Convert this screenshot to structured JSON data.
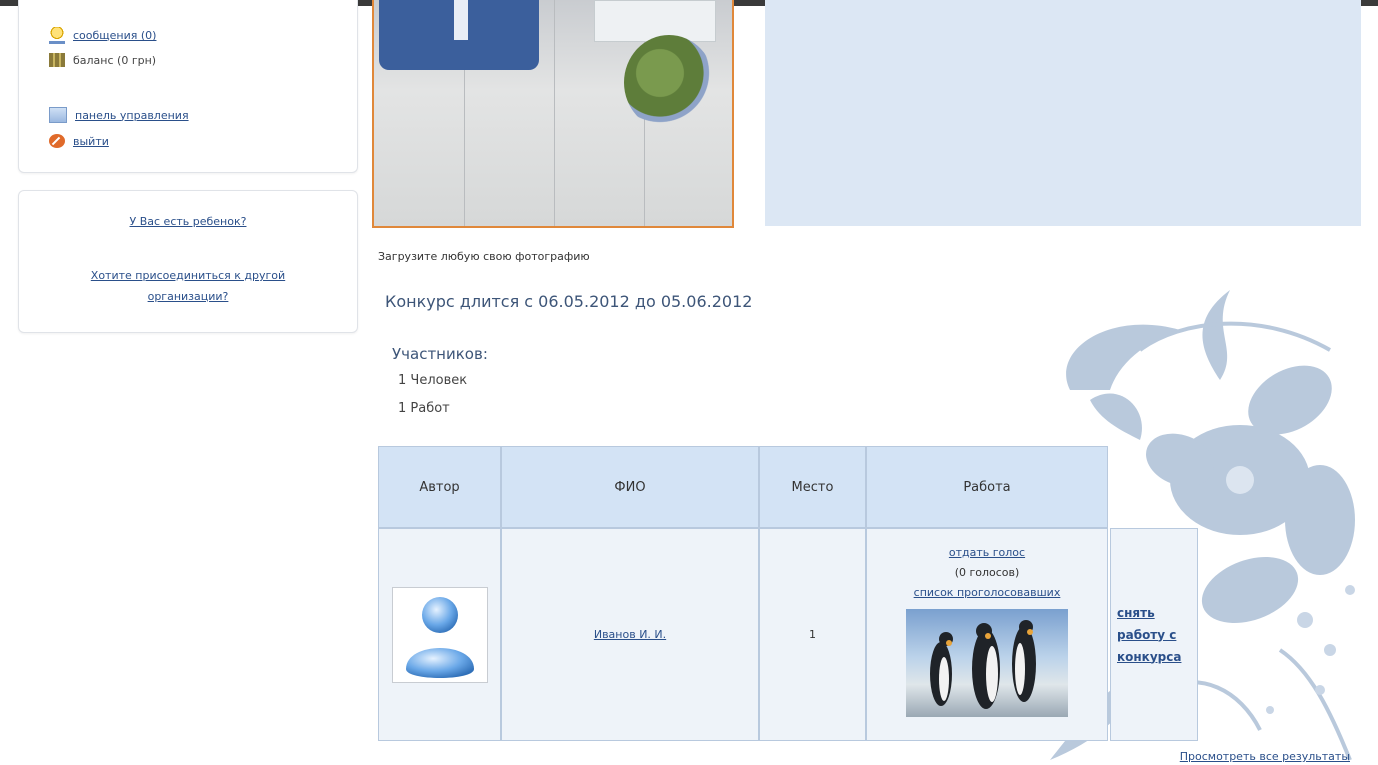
{
  "sidebar": {
    "messages_label": "сообщения (0)",
    "balance_label": "баланс (0 грн)",
    "panel_label": "панель управления",
    "logout_label": "выйти",
    "child_link": "У Вас есть ребенок?",
    "join_link": "Хотите присоединиться к другой организации?"
  },
  "main": {
    "caption": "Загрузите любую свою фотографию",
    "contest_dates": "Конкурс длится с 06.05.2012 до 05.06.2012",
    "participants_title": "Участников:",
    "participants_people": "1 Человек",
    "participants_works": "1 Работ"
  },
  "table": {
    "headers": [
      "Автор",
      "ФИО",
      "Место",
      "Работа"
    ],
    "rows": [
      {
        "name": "Иванов И. И.",
        "place": "1",
        "vote_link": "отдать голос",
        "votes": "(0 голосов)",
        "voters_link": "список проголосовавших",
        "remove_link": "снять работу с конкурса"
      }
    ]
  },
  "footer": {
    "all_results_link": "Просмотреть все результаты"
  },
  "colors": {
    "link": "#2a4f8a",
    "panel_blue": "#dce7f4",
    "table_head": "#d3e3f5",
    "photo_border": "#e0883a"
  }
}
